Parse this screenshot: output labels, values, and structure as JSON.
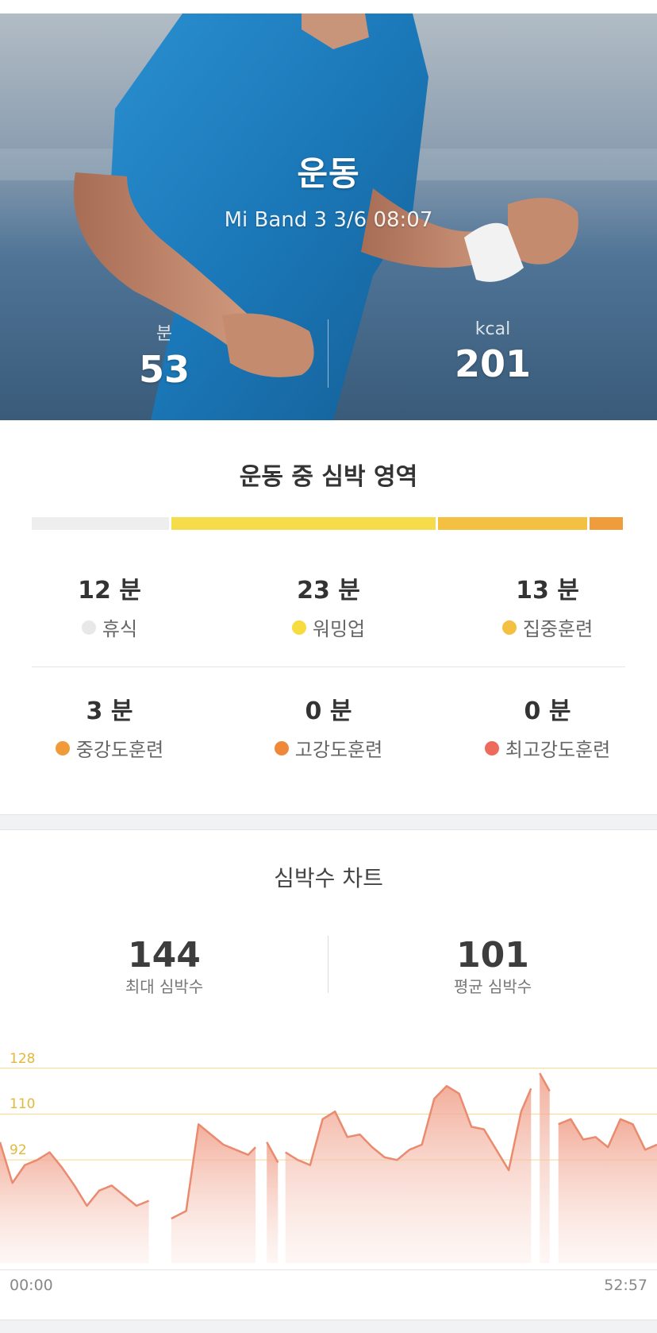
{
  "hero": {
    "title": "운동",
    "subtitle": "Mi Band 3 3/6 08:07",
    "duration": {
      "label": "분",
      "value": "53"
    },
    "calories": {
      "label": "kcal",
      "value": "201"
    }
  },
  "zones": {
    "title": "운동 중 심박 영역",
    "bar": [
      {
        "name": "휴식",
        "color": "#eeeeee",
        "fraction": 0.235
      },
      {
        "name": "워밍업",
        "color": "#f6dc4a",
        "fraction": 0.449
      },
      {
        "name": "집중훈련",
        "color": "#f3c041",
        "fraction": 0.256
      },
      {
        "name": "중강도훈련",
        "color": "#ee9c3c",
        "fraction": 0.06
      }
    ],
    "items": [
      {
        "value": "12 분",
        "name": "휴식",
        "color": "#e8e8e8"
      },
      {
        "value": "23 분",
        "name": "워밍업",
        "color": "#f6dc3f"
      },
      {
        "value": "13 분",
        "name": "집중훈련",
        "color": "#f3c041"
      },
      {
        "value": "3 분",
        "name": "중강도훈련",
        "color": "#f09a3a"
      },
      {
        "value": "0 분",
        "name": "고강도훈련",
        "color": "#f0883a"
      },
      {
        "value": "0 분",
        "name": "최고강도훈련",
        "color": "#ee6a5a"
      }
    ]
  },
  "hr": {
    "title": "심박수 차트",
    "max": {
      "value": "144",
      "label": "최대 심박수"
    },
    "avg": {
      "value": "101",
      "label": "평균 심박수"
    },
    "x_start": "00:00",
    "x_end": "52:57"
  },
  "chart_data": {
    "type": "area",
    "xlabel": "",
    "ylabel": "",
    "x_range": [
      "00:00",
      "52:57"
    ],
    "reference_lines": [
      128,
      110,
      92
    ],
    "ylim": [
      50,
      145
    ],
    "series": [
      {
        "x": [
          0,
          1,
          2,
          3,
          4,
          5,
          6,
          7,
          8,
          9,
          10,
          11,
          12,
          12.8,
          13.8,
          15,
          16,
          17,
          18,
          19,
          20,
          20.6,
          21.5,
          22.4,
          23,
          24,
          25,
          26,
          27,
          28,
          29,
          30,
          31,
          32,
          33,
          34,
          35,
          36,
          37,
          38,
          39,
          40,
          41,
          42,
          42.8,
          43.5,
          44.3,
          45,
          46,
          47,
          48,
          49,
          50,
          51,
          52,
          52.95
        ],
        "y": [
          99,
          83,
          90,
          92,
          95,
          89,
          82,
          74,
          80,
          82,
          78,
          74,
          76,
          67,
          69,
          72,
          106,
          102,
          98,
          96,
          94,
          97,
          99,
          91,
          95,
          92,
          90,
          108,
          111,
          101,
          102,
          97,
          93,
          92,
          96,
          98,
          116,
          121,
          118,
          105,
          104,
          96,
          88,
          111,
          120,
          126,
          119,
          106,
          108,
          100,
          101,
          97,
          108,
          106,
          96,
          98
        ],
        "segments": [
          [
            0,
            12
          ],
          [
            13.8,
            20.6
          ],
          [
            21.5,
            22.4
          ],
          [
            23,
            42.8
          ],
          [
            43.5,
            44.3
          ],
          [
            45,
            52.95
          ]
        ]
      }
    ]
  }
}
